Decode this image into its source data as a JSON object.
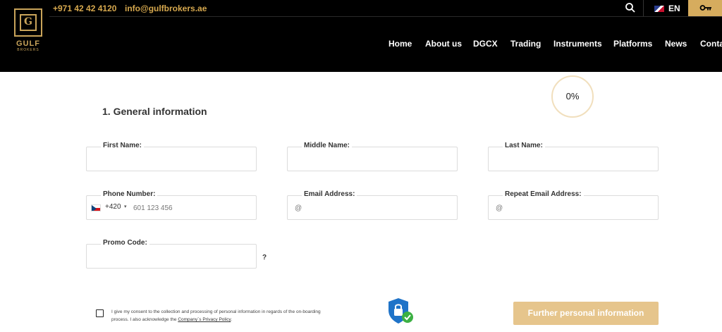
{
  "header": {
    "phone": "+971 42 42 4120",
    "email": "info@gulfbrokers.ae",
    "logo_name": "GULF",
    "logo_sub": "BROKERS",
    "logo_letter": "G",
    "language": "EN",
    "search_icon": "search-icon",
    "key_icon": "key-icon",
    "nav": [
      "Home",
      "About us",
      "DGCX",
      "Trading",
      "Instruments",
      "Platforms",
      "News",
      "Conta"
    ]
  },
  "progress": {
    "value": "0%"
  },
  "form": {
    "section_title": "1. General information",
    "first_name": {
      "label": "First Name:",
      "value": ""
    },
    "middle_name": {
      "label": "Middle Name:",
      "value": ""
    },
    "last_name": {
      "label": "Last Name:",
      "value": ""
    },
    "phone": {
      "label": "Phone Number:",
      "dial_code": "+420",
      "caret": "▾",
      "placeholder": "601 123 456"
    },
    "email": {
      "label": "Email Address:",
      "placeholder": "@"
    },
    "repeat_email": {
      "label": "Repeat Email Address:",
      "placeholder": "@"
    },
    "promo": {
      "label": "Promo Code:",
      "help": "?"
    }
  },
  "consent": {
    "text": "I give my consent to the collection and processing of personal information in regards of the on-boarding process. I also acknowledge the ",
    "link": "Company`s Privacy Policy",
    "end": "."
  },
  "submit": {
    "label": "Further personal information"
  },
  "colors": {
    "accent": "#d6a84e",
    "button": "#e6c58c",
    "shield": "#1f73c8",
    "check": "#3cb043"
  }
}
